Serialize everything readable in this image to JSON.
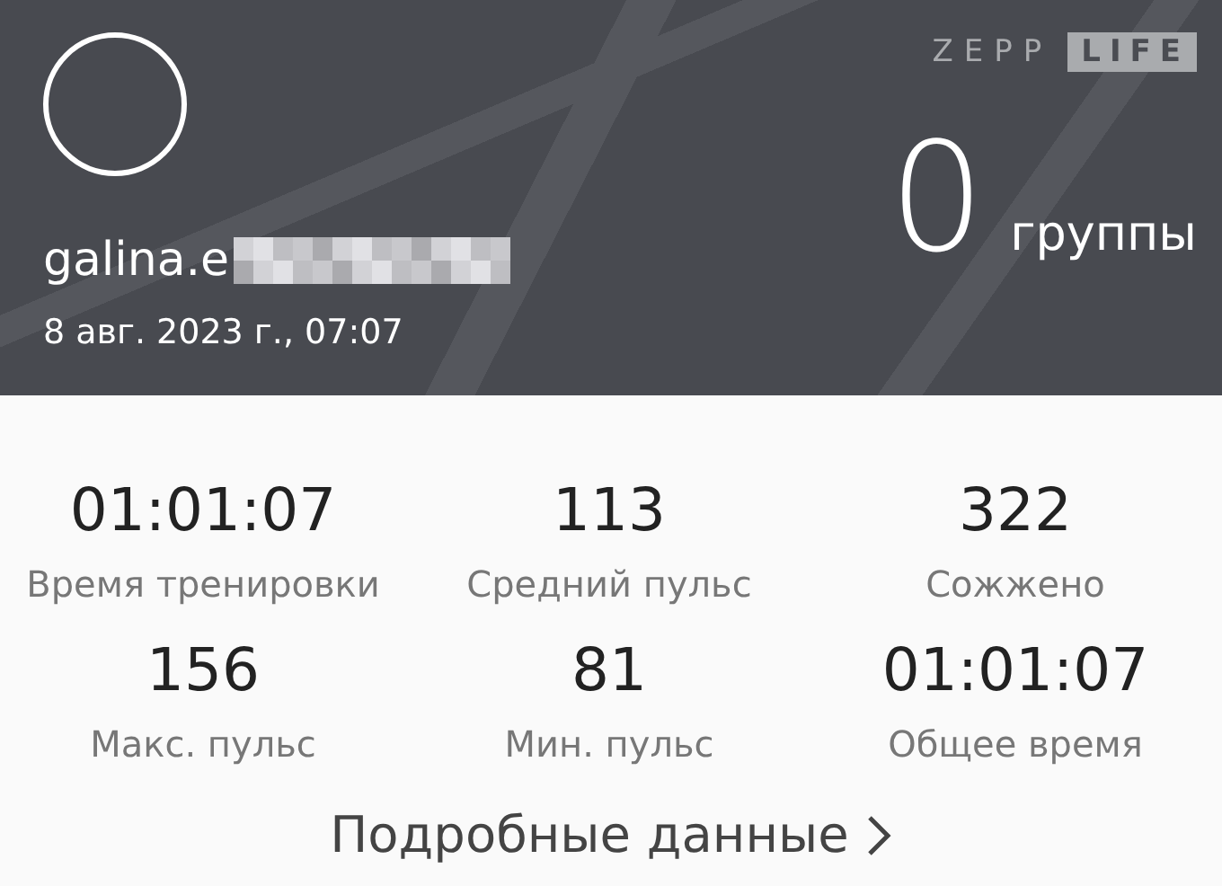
{
  "header": {
    "logo": {
      "brand": "ZEPP",
      "product": "LIFE"
    },
    "username": "galina.e",
    "date": "8 авг. 2023 г., 07:07",
    "count": "0",
    "count_label": "группы"
  },
  "stats": [
    {
      "value": "01:01:07",
      "label": "Время тренировки"
    },
    {
      "value": "113",
      "label": "Средний пульс"
    },
    {
      "value": "322",
      "label": "Сожжено"
    },
    {
      "value": "156",
      "label": "Макс. пульс"
    },
    {
      "value": "81",
      "label": "Мин. пульс"
    },
    {
      "value": "01:01:07",
      "label": "Общее время"
    }
  ],
  "details_link": "Подробные данные"
}
